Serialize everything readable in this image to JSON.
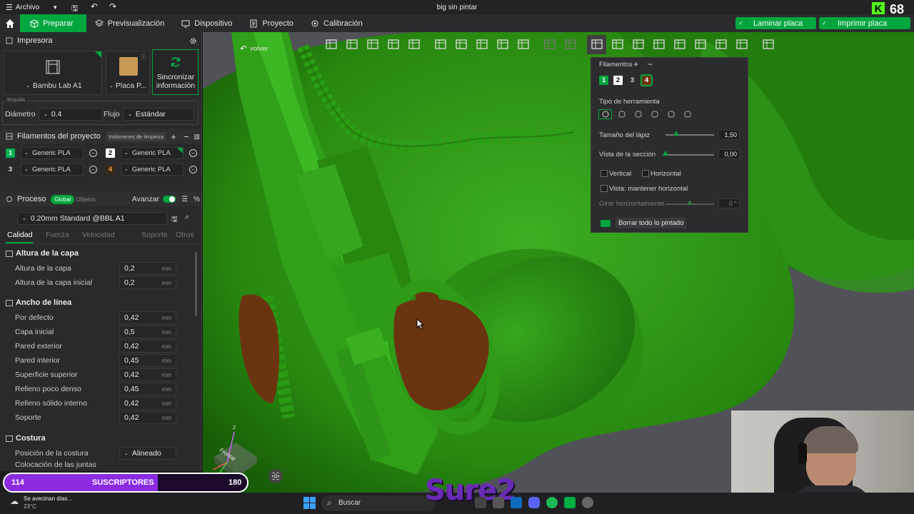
{
  "titlebar": {
    "menu": "Archivo",
    "title": "big sin pintar",
    "counter": "68"
  },
  "menubar": {
    "tabs": [
      {
        "label": "Preparar"
      },
      {
        "label": "Previsualización"
      },
      {
        "label": "Dispositivo"
      },
      {
        "label": "Proyecto"
      },
      {
        "label": "Calibración"
      }
    ],
    "slice_label": "Laminar placa",
    "print_label": "Imprimir placa"
  },
  "printer": {
    "section": "Impresora",
    "printer_name": "Bambu Lab A1",
    "plate": "Placa P...",
    "sync": "Sincronizar información",
    "nozzle_group": "Boquilla",
    "diameter_label": "Diámetro",
    "diameter_value": "0.4",
    "flow_label": "Flujo",
    "flow_value": "Estándar"
  },
  "filaments": {
    "section": "Filamentos del proyecto",
    "cleaning": "Volúmenes de limpieza",
    "items": [
      {
        "num": "1",
        "name": "Generic PLA",
        "color": "#00b050"
      },
      {
        "num": "2",
        "name": "Generic PLA",
        "color": "#ffffff"
      },
      {
        "num": "3",
        "name": "Generic PLA",
        "color": "#2a2a2c"
      },
      {
        "num": "4",
        "name": "Generic PLA",
        "color": "#6b3410"
      }
    ]
  },
  "process": {
    "section": "Proceso",
    "toggle_global": "Global",
    "toggle_objects": "Objetos",
    "advanced": "Avanzar",
    "profile": "0.20mm Standard @BBL A1",
    "tabs": [
      "Calidad",
      "Fuerza",
      "Velocidad",
      "Soporte",
      "Otros"
    ],
    "groups": [
      {
        "title": "Altura de la capa",
        "params": [
          {
            "label": "Altura de la capa",
            "value": "0,2",
            "unit": "mm"
          },
          {
            "label": "Altura de la capa inicial",
            "value": "0,2",
            "unit": "mm"
          }
        ]
      },
      {
        "title": "Ancho de línea",
        "params": [
          {
            "label": "Por defecto",
            "value": "0,42",
            "unit": "mm"
          },
          {
            "label": "Capa inicial",
            "value": "0,5",
            "unit": "mm"
          },
          {
            "label": "Pared exterior",
            "value": "0,42",
            "unit": "mm"
          },
          {
            "label": "Pared interior",
            "value": "0,45",
            "unit": "mm"
          },
          {
            "label": "Superficie superior",
            "value": "0,42",
            "unit": "mm"
          },
          {
            "label": "Relleno poco denso",
            "value": "0,45",
            "unit": "mm"
          },
          {
            "label": "Relleno sólido interno",
            "value": "0,42",
            "unit": "mm"
          },
          {
            "label": "Soporte",
            "value": "0,42",
            "unit": "mm"
          }
        ]
      },
      {
        "title": "Costura",
        "params": [
          {
            "label": "Posición de la costura",
            "value": "Alineado",
            "unit": ""
          },
          {
            "label": "Colocación de las juntas",
            "value": "",
            "unit": ""
          }
        ]
      }
    ]
  },
  "viewport": {
    "back": "volver",
    "axis_front": "Frontal",
    "axis_z": "Z"
  },
  "paint": {
    "filaments_label": "Filamentos",
    "filament_nums": [
      "1",
      "2",
      "3",
      "4"
    ],
    "tool_type_label": "Tipo de herramienta",
    "pen_size_label": "Tamaño del lápiz",
    "pen_size_value": "1,50",
    "pen_size_fraction": 0.22,
    "section_view_label": "Vista de la sección",
    "section_view_value": "0,00",
    "section_view_fraction": 0.0,
    "vertical": "Vertical",
    "horizontal": "Horizontal",
    "keep_horizontal": "Vista: mantener horizontal",
    "rotate_label": "Girar horizontalmente",
    "rotate_value": "0 °",
    "rotate_fraction": 0.5,
    "clear_all": "Borrar todo lo pintado"
  },
  "overlay": {
    "subs_current": "114",
    "subs_label": "SUSCRIPTORES",
    "subs_goal": "180",
    "subs_fraction": 0.633,
    "brand": "Sure2"
  },
  "taskbar": {
    "weather_text": "Se avecinan días...",
    "temperature": "23°C",
    "search": "Buscar"
  },
  "colors": {
    "accent": "#00a63e",
    "model": "#2e9a16",
    "paint": "#6b3410"
  }
}
